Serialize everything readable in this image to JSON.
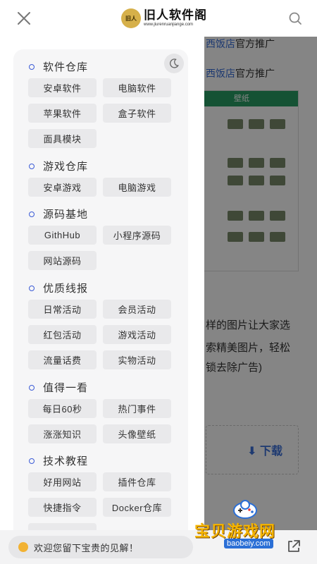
{
  "header": {
    "logo_badge": "旧人",
    "logo_title": "旧人软件阁",
    "logo_url": "www.jiurenruanjiange.com"
  },
  "background": {
    "lines": [
      {
        "highlight": "西饭店",
        "text": "官方推广"
      },
      {
        "highlight": "西饭店",
        "text": "官方推广"
      }
    ],
    "screenshot_bar": "壁纸",
    "paragraph": [
      "样的图片让大家选",
      "索精美图片，轻松",
      "锁去除广告)"
    ],
    "download": "下载"
  },
  "menu": {
    "sections": [
      {
        "title": "软件仓库",
        "items": [
          "安卓软件",
          "电脑软件",
          "苹果软件",
          "盒子软件",
          "面具模块"
        ]
      },
      {
        "title": "游戏仓库",
        "items": [
          "安卓游戏",
          "电脑游戏"
        ]
      },
      {
        "title": "源码基地",
        "items": [
          "GithHub",
          "小程序源码",
          "网站源码"
        ]
      },
      {
        "title": "优质线报",
        "items": [
          "日常活动",
          "会员活动",
          "红包活动",
          "游戏活动",
          "流量话费",
          "实物活动"
        ]
      },
      {
        "title": "值得一看",
        "items": [
          "每日60秒",
          "热门事件",
          "涨涨知识",
          "头像壁纸"
        ]
      },
      {
        "title": "技术教程",
        "items": [
          "好用网站",
          "插件仓库",
          "快捷指令",
          "Docker仓库"
        ]
      }
    ]
  },
  "bottom": {
    "comment_placeholder": "欢迎您留下宝贵的见解！"
  },
  "watermark": {
    "text": "宝贝游戏网",
    "url": "baobeiy.com"
  },
  "colors": {
    "accent": "#3b5bd6",
    "chip_bg": "#e9e9eb",
    "panel_bg": "#f6f6f7",
    "watermark": "#f5b400"
  }
}
